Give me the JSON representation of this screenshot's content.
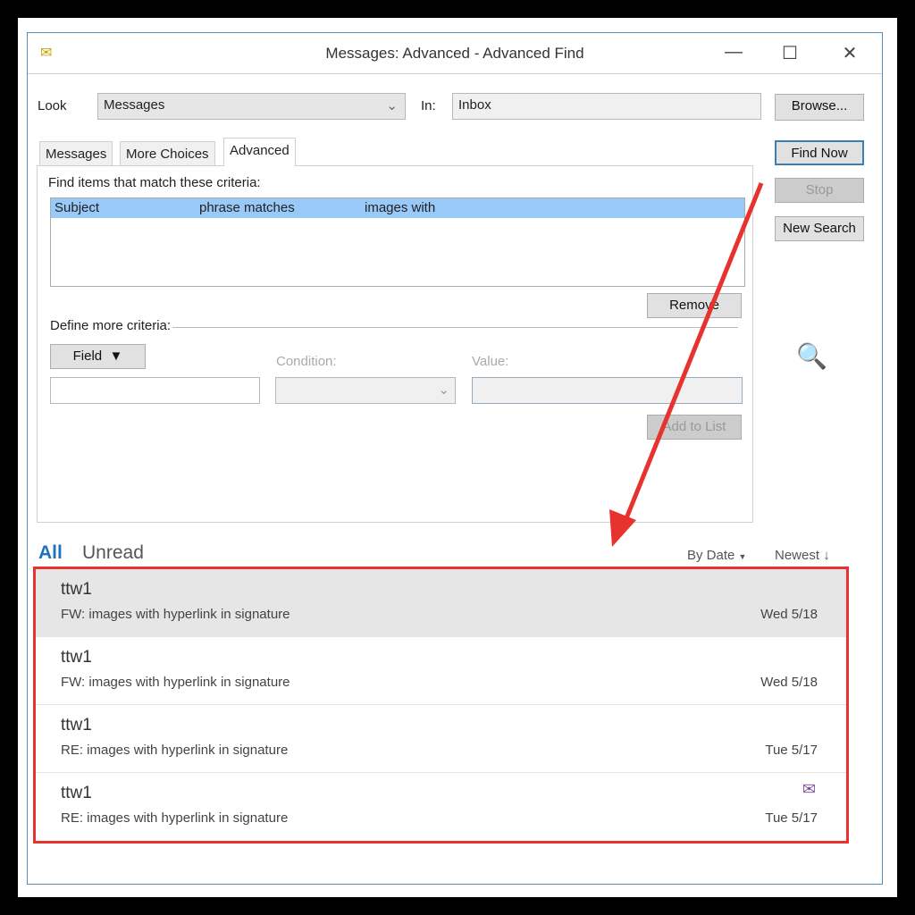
{
  "window": {
    "title": "Messages: Advanced - Advanced Find",
    "minimize": "—",
    "maximize": "☐",
    "close": "✕"
  },
  "look": {
    "label": "Look",
    "value": "Messages",
    "in_label": "In:",
    "in_value": "Inbox"
  },
  "buttons": {
    "browse": "Browse...",
    "find_now": "Find Now",
    "stop": "Stop",
    "new_search": "New Search",
    "remove": "Remove",
    "field": "Field",
    "add_to_list": "Add to List"
  },
  "tabs": [
    "Messages",
    "More Choices",
    "Advanced"
  ],
  "criteria": {
    "heading": "Find items that match these criteria:",
    "rows": [
      {
        "field": "Subject",
        "condition": "phrase matches",
        "value": "images with"
      }
    ],
    "define_more": "Define more criteria:",
    "condition_label": "Condition:",
    "value_label": "Value:"
  },
  "results": {
    "filters": [
      "All",
      "Unread"
    ],
    "sort": "By Date",
    "order": "Newest",
    "items": [
      {
        "from": "ttw1",
        "subject": "FW: images with hyperlink in signature",
        "date": "Wed 5/18"
      },
      {
        "from": "ttw1",
        "subject": "FW: images with hyperlink in signature",
        "date": "Wed 5/18"
      },
      {
        "from": "ttw1",
        "subject": "RE: images with hyperlink in signature",
        "date": "Tue 5/17"
      },
      {
        "from": "ttw1",
        "subject": "RE: images with hyperlink in signature",
        "date": "Tue 5/17"
      }
    ]
  },
  "colors": {
    "accent": "#1e73be",
    "highlight": "#99c9f8",
    "annotation": "#e8322e"
  }
}
